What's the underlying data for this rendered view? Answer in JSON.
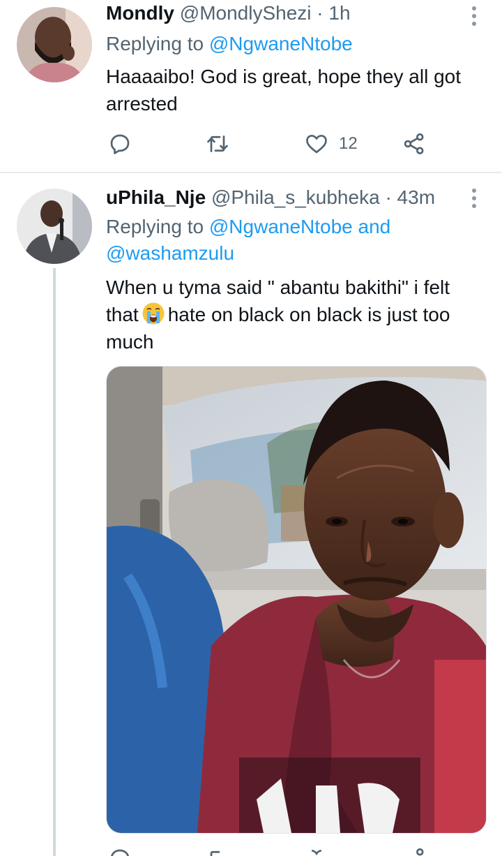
{
  "tweets": [
    {
      "name": "Mondly",
      "handle": "@MondlyShezi",
      "separator": "·",
      "time": "1h",
      "replying_prefix": "Replying to",
      "replying_to": "@NgwaneNtobe",
      "text_line1": "Haaaaibo! God is great, hope they all got",
      "text_line2": "arrested",
      "actions": {
        "reply_icon": "reply-icon",
        "retweet_icon": "retweet-icon",
        "like_icon": "heart-icon",
        "like_count": "12",
        "share_icon": "share-icon"
      }
    },
    {
      "name": "uPhila_Nje",
      "handle": "@Phila_s_kubheka",
      "separator": "·",
      "time": "43m",
      "replying_prefix": "Replying to",
      "replying_to": "@NgwaneNtobe",
      "replying_and": "and",
      "replying_to_2": "@washamzulu",
      "text_line1": "When u tyma said \" abantu bakithi\" i felt",
      "text_line2_a": "that",
      "text_line2_b": "hate on black on black is just too",
      "text_line3": "much",
      "emoji": "loudly-crying-face-emoji",
      "media": "photo"
    }
  ],
  "colors": {
    "accent": "#1d9bf0",
    "secondary_text": "#536471",
    "divider": "#e7ebee"
  }
}
